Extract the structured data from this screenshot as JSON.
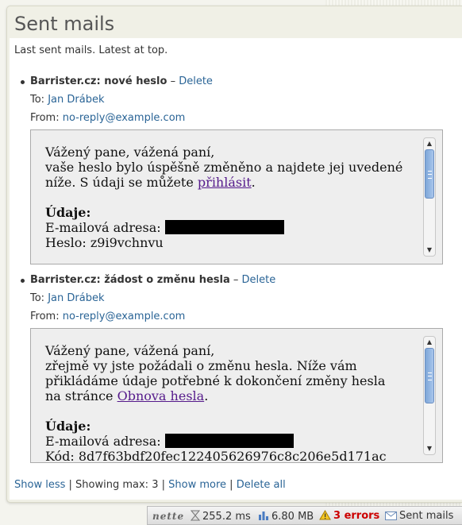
{
  "panel": {
    "title": "Sent mails",
    "intro": "Last sent mails. Latest at top."
  },
  "mails": [
    {
      "subject": "Barrister.cz: nové heslo",
      "separator": "–",
      "delete_label": "Delete",
      "to_label": "To:",
      "to_value": "Jan Drábek",
      "from_label": "From:",
      "from_value": "no-reply@example.com",
      "body": {
        "line1": "Vážený pane, vážená paní,",
        "line2": "vaše heslo bylo úspěšně změněno a najdete jej uvedené",
        "line3_pre": "níže. S údaji se můžete ",
        "line3_link": "přihlásit",
        "line3_post": ".",
        "section": "Údaje:",
        "email_label": "E-mailová adresa:",
        "password_line": "Heslo: z9i9vchnvu"
      }
    },
    {
      "subject": "Barrister.cz: žádost o změnu hesla",
      "separator": "–",
      "delete_label": "Delete",
      "to_label": "To:",
      "to_value": "Jan Drábek",
      "from_label": "From:",
      "from_value": "no-reply@example.com",
      "body": {
        "line1": "Vážený pane, vážená paní,",
        "line2": "zřejmě vy jste požádali o změnu hesla. Níže vám",
        "line3": "přikládáme údaje potřebné k dokončení změny hesla",
        "line4_pre": "na stránce ",
        "line4_link": "Obnova hesla",
        "line4_post": ".",
        "section": "Údaje:",
        "email_label": "E-mailová adresa:",
        "code_line": "Kód: 8d7f63bdf20fec122405626976c8c206e5d171ac"
      }
    }
  ],
  "footer": {
    "show_less": "Show less",
    "sep": "|",
    "showing_max": "Showing max: 3",
    "show_more": "Show more",
    "delete_all": "Delete all"
  },
  "debugbar": {
    "logo": "nette",
    "time": "255.2 ms",
    "memory": "6.80 MB",
    "errors": "3 errors",
    "panel": "Sent mails"
  },
  "colors": {
    "link": "#2a6496",
    "visited_link": "#551a8b",
    "error": "#cc0000",
    "scroll_thumb": "#8fb4e3"
  }
}
